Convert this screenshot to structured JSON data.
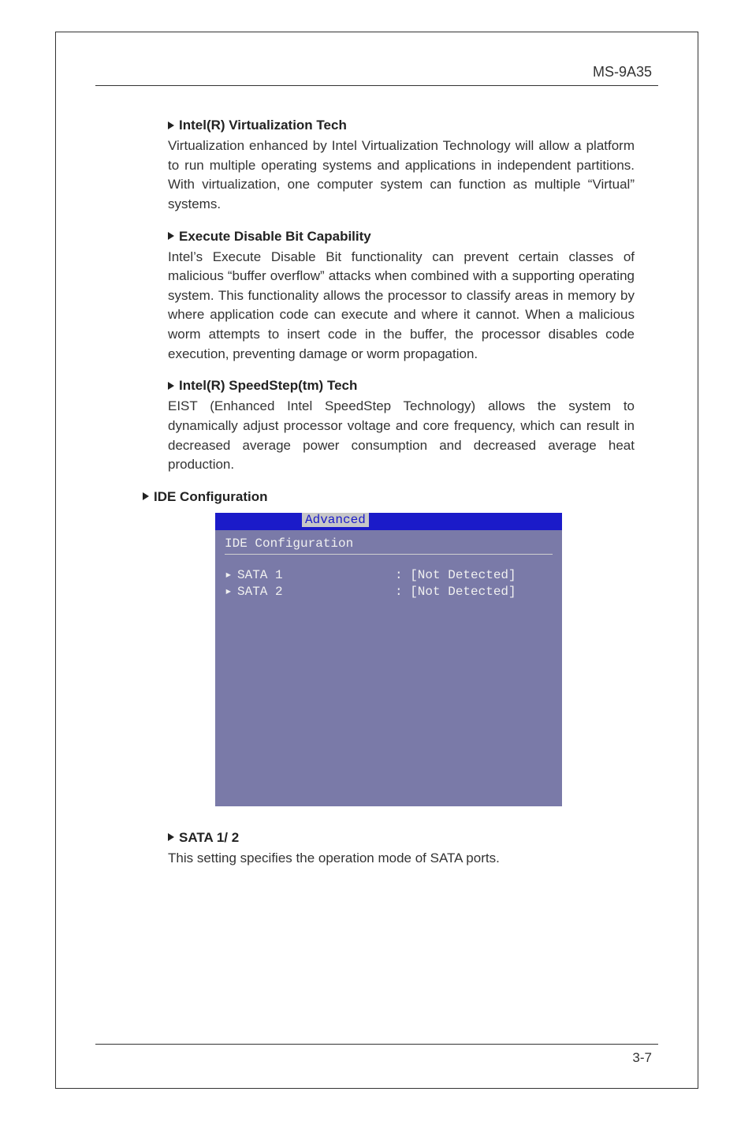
{
  "header": {
    "model": "MS-9A35"
  },
  "sections": {
    "virt": {
      "title": "Intel(R) Virtualization Tech",
      "body": "Virtualization enhanced by Intel Virtualization Technology will allow a platform to run multiple operating systems and applications in independent partitions. With virtualization, one computer system can function as multiple “Virtual” systems."
    },
    "xd": {
      "title": "Execute Disable Bit Capability",
      "body": "Intel’s Execute Disable Bit functionality can prevent certain classes of malicious “buffer overflow” attacks when combined with a supporting operating system. This functionality allows the processor to classify areas in memory by where application code can execute and where it cannot. When a malicious worm attempts to insert code in the buffer, the processor disables code execution, preventing damage or worm propagation."
    },
    "ss": {
      "title": "Intel(R) SpeedStep(tm) Tech",
      "body": "EIST (Enhanced Intel SpeedStep Technology) allows the system to dynamically adjust processor voltage and core frequency, which can result in decreased average power consumption and decreased average heat production."
    },
    "ide": {
      "title": "IDE Configuration"
    },
    "sata": {
      "title": "SATA 1/ 2",
      "body": "This setting specifies the operation mode of SATA ports."
    }
  },
  "bios": {
    "tab": "Advanced",
    "heading": "IDE Configuration",
    "rows": [
      {
        "label": "SATA 1",
        "value": "[Not Detected]"
      },
      {
        "label": "SATA 2",
        "value": "[Not Detected]"
      }
    ]
  },
  "footer": {
    "page": "3-7"
  }
}
